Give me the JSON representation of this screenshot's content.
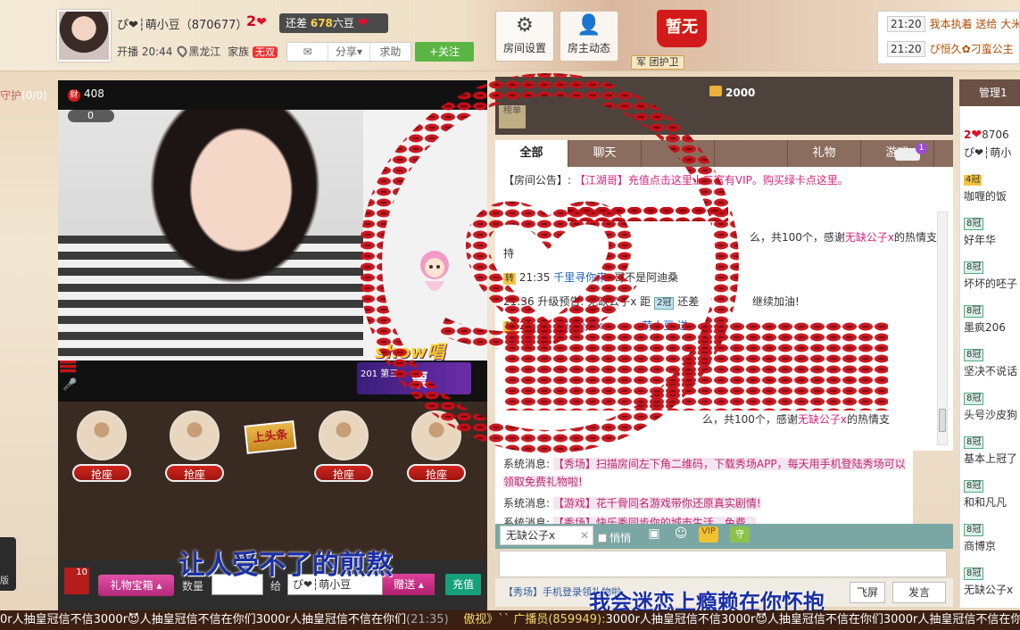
{
  "header": {
    "host_name": "ぴ❤┆萌小豆",
    "host_id": "（870677）",
    "level": "2",
    "gap_prefix": "还差",
    "gap_value": "678",
    "gap_suffix": "六豆",
    "live_time": "开播 20:44",
    "location": "黑龙江",
    "family_label": "家族",
    "family_value": "无双",
    "share_label": "分享",
    "help_label": "求助",
    "follow_label": "+关注",
    "room_settings_label": "房间设置",
    "host_activity_label": "房主动态",
    "no_rank_label": "暂无",
    "guard_group_label": "团护卫",
    "guard_icon_label": "军"
  },
  "feed": [
    {
      "time": "21:20",
      "text": "我本执着 送给 大米"
    },
    {
      "time": "21:20",
      "text": "ぴ恒久✿刁蛮公主"
    }
  ],
  "left": {
    "guard_label": "守护",
    "guard_count": "(0/0)",
    "side_label": "版"
  },
  "video": {
    "wealth_label": "财",
    "wealth_value": "408",
    "zero_value": "0",
    "show_logo": "show唱",
    "vote_label": "票",
    "vote_small": "201 第三"
  },
  "seats": [
    {
      "label": "抢座"
    },
    {
      "label": "抢座"
    },
    {
      "label": "抢座"
    },
    {
      "label": "抢座"
    }
  ],
  "headline_label": "上头条",
  "lyrics": {
    "line1": "让人受不了的煎熬",
    "line2": "我会迷恋上瘾赖在你怀抱"
  },
  "giftbar": {
    "count_badge": "10",
    "gift_box_label": "礼物宝箱",
    "qty_label": "数量",
    "give_label": "给",
    "recipient": "ぴ❤┆萌小豆",
    "send_label": "赠送",
    "recharge_label": "充值"
  },
  "ranking": {
    "coins": "2000",
    "rank_tab": "榜单"
  },
  "chat_tabs": [
    "全部",
    "聊天",
    "",
    "",
    "礼物",
    "游戏"
  ],
  "car_badge": "1",
  "chat": {
    "announcement_label": "【房间公告】:",
    "announcement_text": "【江湖哥】充值点击这里",
    "announcement_tail": "上三富有VIP。购买绿卡点这里。",
    "line_thanks1_prefix": "么，共100个，感谢",
    "line_thanks1_user": "无缺公子x",
    "line_thanks1_suffix": "的热情支",
    "line_thanks1_cont": "持",
    "line2_tag": "转",
    "line2_time": "21:35",
    "line2_user": "千里寻你来:",
    "line2_text": "哥不是阿迪桑",
    "line3_text": "21:36 升级预告: 无缺公子x 距",
    "line3_level": "2冠",
    "line3_tail": "还差",
    "line3_end": "继续加油!",
    "line4_tag": "转",
    "line4_time": "21:36",
    "line4_user": "无缺公子x",
    "line4_to": "萌小豆 送",
    "line5_prefix": "么，共100个，感谢",
    "line5_user": "无缺公子x",
    "line5_suffix": "的热情支"
  },
  "system": {
    "line1_label": "系统消息:",
    "line1_tag": "【秀场】",
    "line1_text": "扫描房间左下角二维码，下载秀场APP，每天用手机登陆秀场可以",
    "line1_cont": "领取免费礼物啦!",
    "line2_label": "系统消息:",
    "line2_text": "【游戏】花千骨同名游戏带你还原真实剧情!",
    "line3_label": "系统消息:",
    "line3_text": "【秀场】快乐秀同步你的城市生活，免费..."
  },
  "input": {
    "target_user": "无缺公子x",
    "quiet_label": "悄悄",
    "hint": "【秀场】手机登录领礼物啦",
    "fly_label": "飞屏",
    "send_label": "发言"
  },
  "right_col": {
    "admin_tab": "管理1",
    "items": [
      {
        "badge": "2",
        "name": "8706"
      },
      {
        "badge": "",
        "name": "ぴ❤┆萌小"
      },
      {
        "badge": "4冠",
        "name": "咖喱的饭"
      },
      {
        "badge": "8冠",
        "name": "好年华"
      },
      {
        "badge": "8冠",
        "name": "坏坏的呸子"
      },
      {
        "badge": "8冠",
        "name": "墨疯206"
      },
      {
        "badge": "8冠",
        "name": "坚决不说话"
      },
      {
        "badge": "8冠",
        "name": "头号沙皮狗"
      },
      {
        "badge": "8冠",
        "name": "基本上冠了"
      },
      {
        "badge": "8冠",
        "name": "和和凡凡"
      },
      {
        "badge": "8冠",
        "name": "商博京"
      },
      {
        "badge": "8冠",
        "name": "无缺公子x"
      }
    ]
  },
  "marquee": {
    "left_text": "0r人抽皇冠信不信3000r",
    "middle_text": "人抽皇冠信不信在你们3000r人抽皇冠信不信在你们",
    "time": "(21:35)",
    "announcer": "傲视》`` 广播员(859949):",
    "right_text": "3000r人抽皇冠信不信3000r",
    "right_text2": "人抽皇冠信不信在你们3000r人抽皇冠信不信在你们"
  }
}
